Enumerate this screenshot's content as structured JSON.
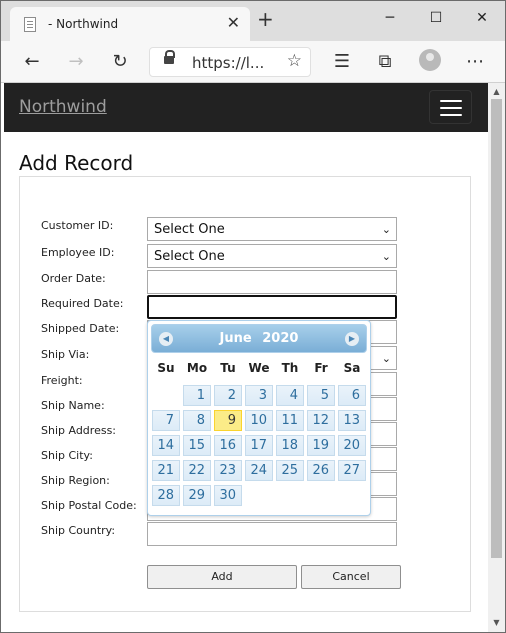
{
  "browser": {
    "tab_title": "- Northwind",
    "url": "https://l...",
    "new_tab": "+",
    "tab_close": "✕",
    "window_minimize": "─",
    "window_maximize": "☐",
    "window_close": "✕"
  },
  "site": {
    "brand": "Northwind"
  },
  "page": {
    "title": "Add Record"
  },
  "form": {
    "customer_id": {
      "label": "Customer ID:",
      "value": "Select One"
    },
    "employee_id": {
      "label": "Employee ID:",
      "value": "Select One"
    },
    "order_date": {
      "label": "Order Date:"
    },
    "required_date": {
      "label": "Required Date:"
    },
    "shipped_date": {
      "label": "Shipped Date:"
    },
    "ship_via": {
      "label": "Ship Via:"
    },
    "freight": {
      "label": "Freight:"
    },
    "ship_name": {
      "label": "Ship Name:"
    },
    "ship_address": {
      "label": "Ship Address:"
    },
    "ship_city": {
      "label": "Ship City:"
    },
    "ship_region": {
      "label": "Ship Region:"
    },
    "ship_postal_code": {
      "label": "Ship Postal Code:"
    },
    "ship_country": {
      "label": "Ship Country:"
    },
    "add_label": "Add",
    "cancel_label": "Cancel"
  },
  "datepicker": {
    "month": "June",
    "year": "2020",
    "weekdays": [
      "Su",
      "Mo",
      "Tu",
      "We",
      "Th",
      "Fr",
      "Sa"
    ],
    "first_weekday_index": 1,
    "days": [
      "1",
      "2",
      "3",
      "4",
      "5",
      "6",
      "7",
      "8",
      "9",
      "10",
      "11",
      "12",
      "13",
      "14",
      "15",
      "16",
      "17",
      "18",
      "19",
      "20",
      "21",
      "22",
      "23",
      "24",
      "25",
      "26",
      "27",
      "28",
      "29",
      "30"
    ],
    "today": "9"
  },
  "colors": {
    "site_nav_bg": "#222222",
    "brand": "#9d9d9d",
    "datepicker_header": "#7aaed6",
    "datepicker_today": "#fbec88"
  }
}
